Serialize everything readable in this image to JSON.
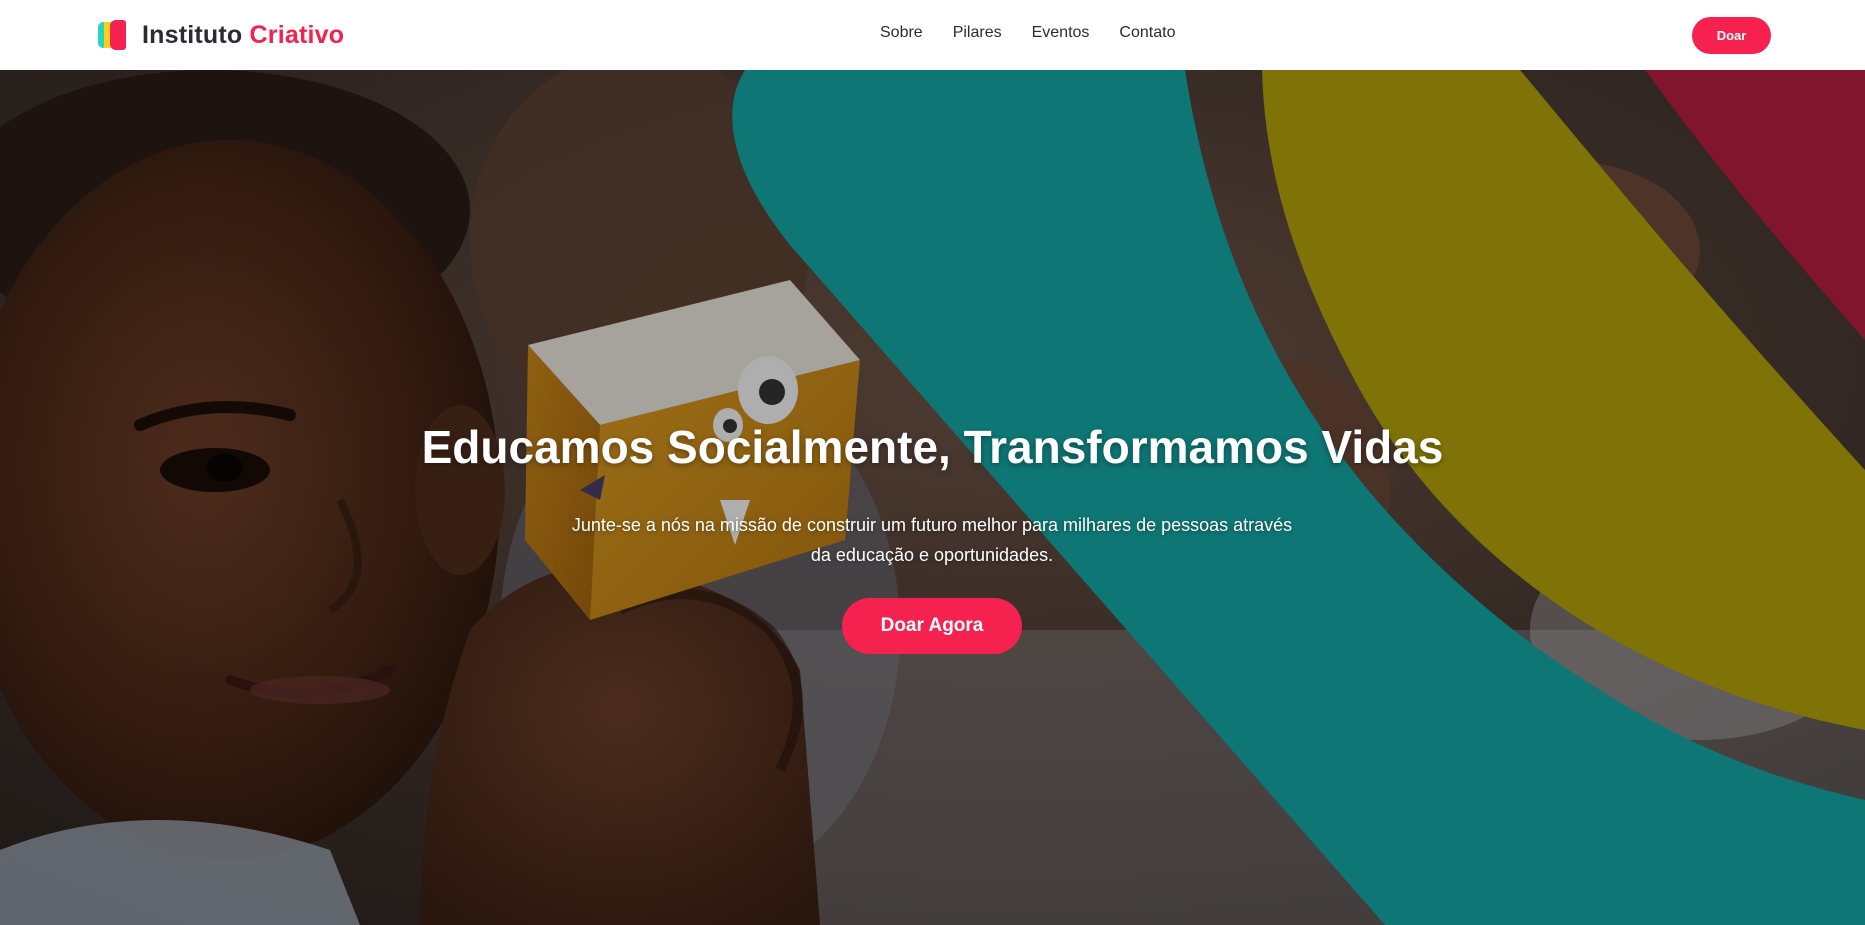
{
  "header": {
    "logo": {
      "name_part1": "Instituto",
      "name_part2": "Criativo"
    },
    "nav": [
      {
        "label": "Sobre"
      },
      {
        "label": "Pilares"
      },
      {
        "label": "Eventos"
      },
      {
        "label": "Contato"
      }
    ],
    "donate_label": "Doar"
  },
  "hero": {
    "title": "Educamos Socialmente, Transformamos Vidas",
    "subtitle": "Junte-se a nós na missão de construir um futuro melhor para milhares de pessoas através da educação e oportunidades.",
    "cta_label": "Doar Agora"
  },
  "colors": {
    "accent": "#f5224f",
    "teal": "#0e7674",
    "olive": "#7f7307",
    "crimson": "#80152d",
    "text_dark": "#2b2b33"
  }
}
